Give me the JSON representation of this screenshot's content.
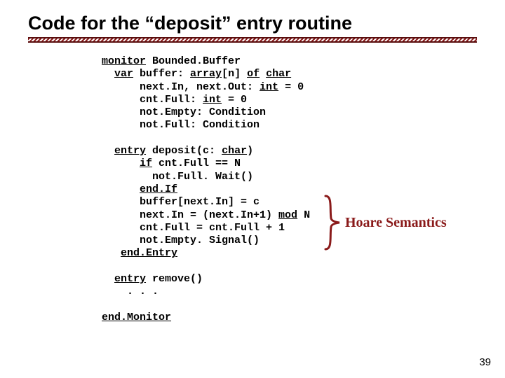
{
  "title": "Code for the “deposit” entry routine",
  "code": {
    "l1a": "monitor",
    "l1b": " Bounded.Buffer",
    "l2a": "  ",
    "l2b": "var",
    "l2c": " buffer: ",
    "l2d": "array",
    "l2e": "[n] ",
    "l2f": "of",
    "l2g": " ",
    "l2h": "char",
    "l3a": "      next.In, next.Out: ",
    "l3b": "int",
    "l3c": " = 0",
    "l4a": "      cnt.Full: ",
    "l4b": "int",
    "l4c": " = 0",
    "l5": "      not.Empty: Condition",
    "l6": "      not.Full: Condition",
    "blank1": "",
    "l7a": "  ",
    "l7b": "entry",
    "l7c": " deposit(c: ",
    "l7d": "char",
    "l7e": ")",
    "l8a": "      ",
    "l8b": "if",
    "l8c": " cnt.Full == N",
    "l9": "        not.Full. Wait()",
    "l10a": "      ",
    "l10b": "end.If",
    "l11": "      buffer[next.In] = c",
    "l12a": "      next.In = (next.In+1) ",
    "l12b": "mod",
    "l12c": " N",
    "l13": "      cnt.Full = cnt.Full + 1",
    "l14": "      not.Empty. Signal()",
    "l15a": "   ",
    "l15b": "end.Entry",
    "blank2": "",
    "l16a": "  ",
    "l16b": "entry",
    "l16c": " remove()",
    "l17": "    . . .",
    "blank3": "",
    "l18": "end.Monitor"
  },
  "annotation": "Hoare Semantics",
  "page_number": "39"
}
